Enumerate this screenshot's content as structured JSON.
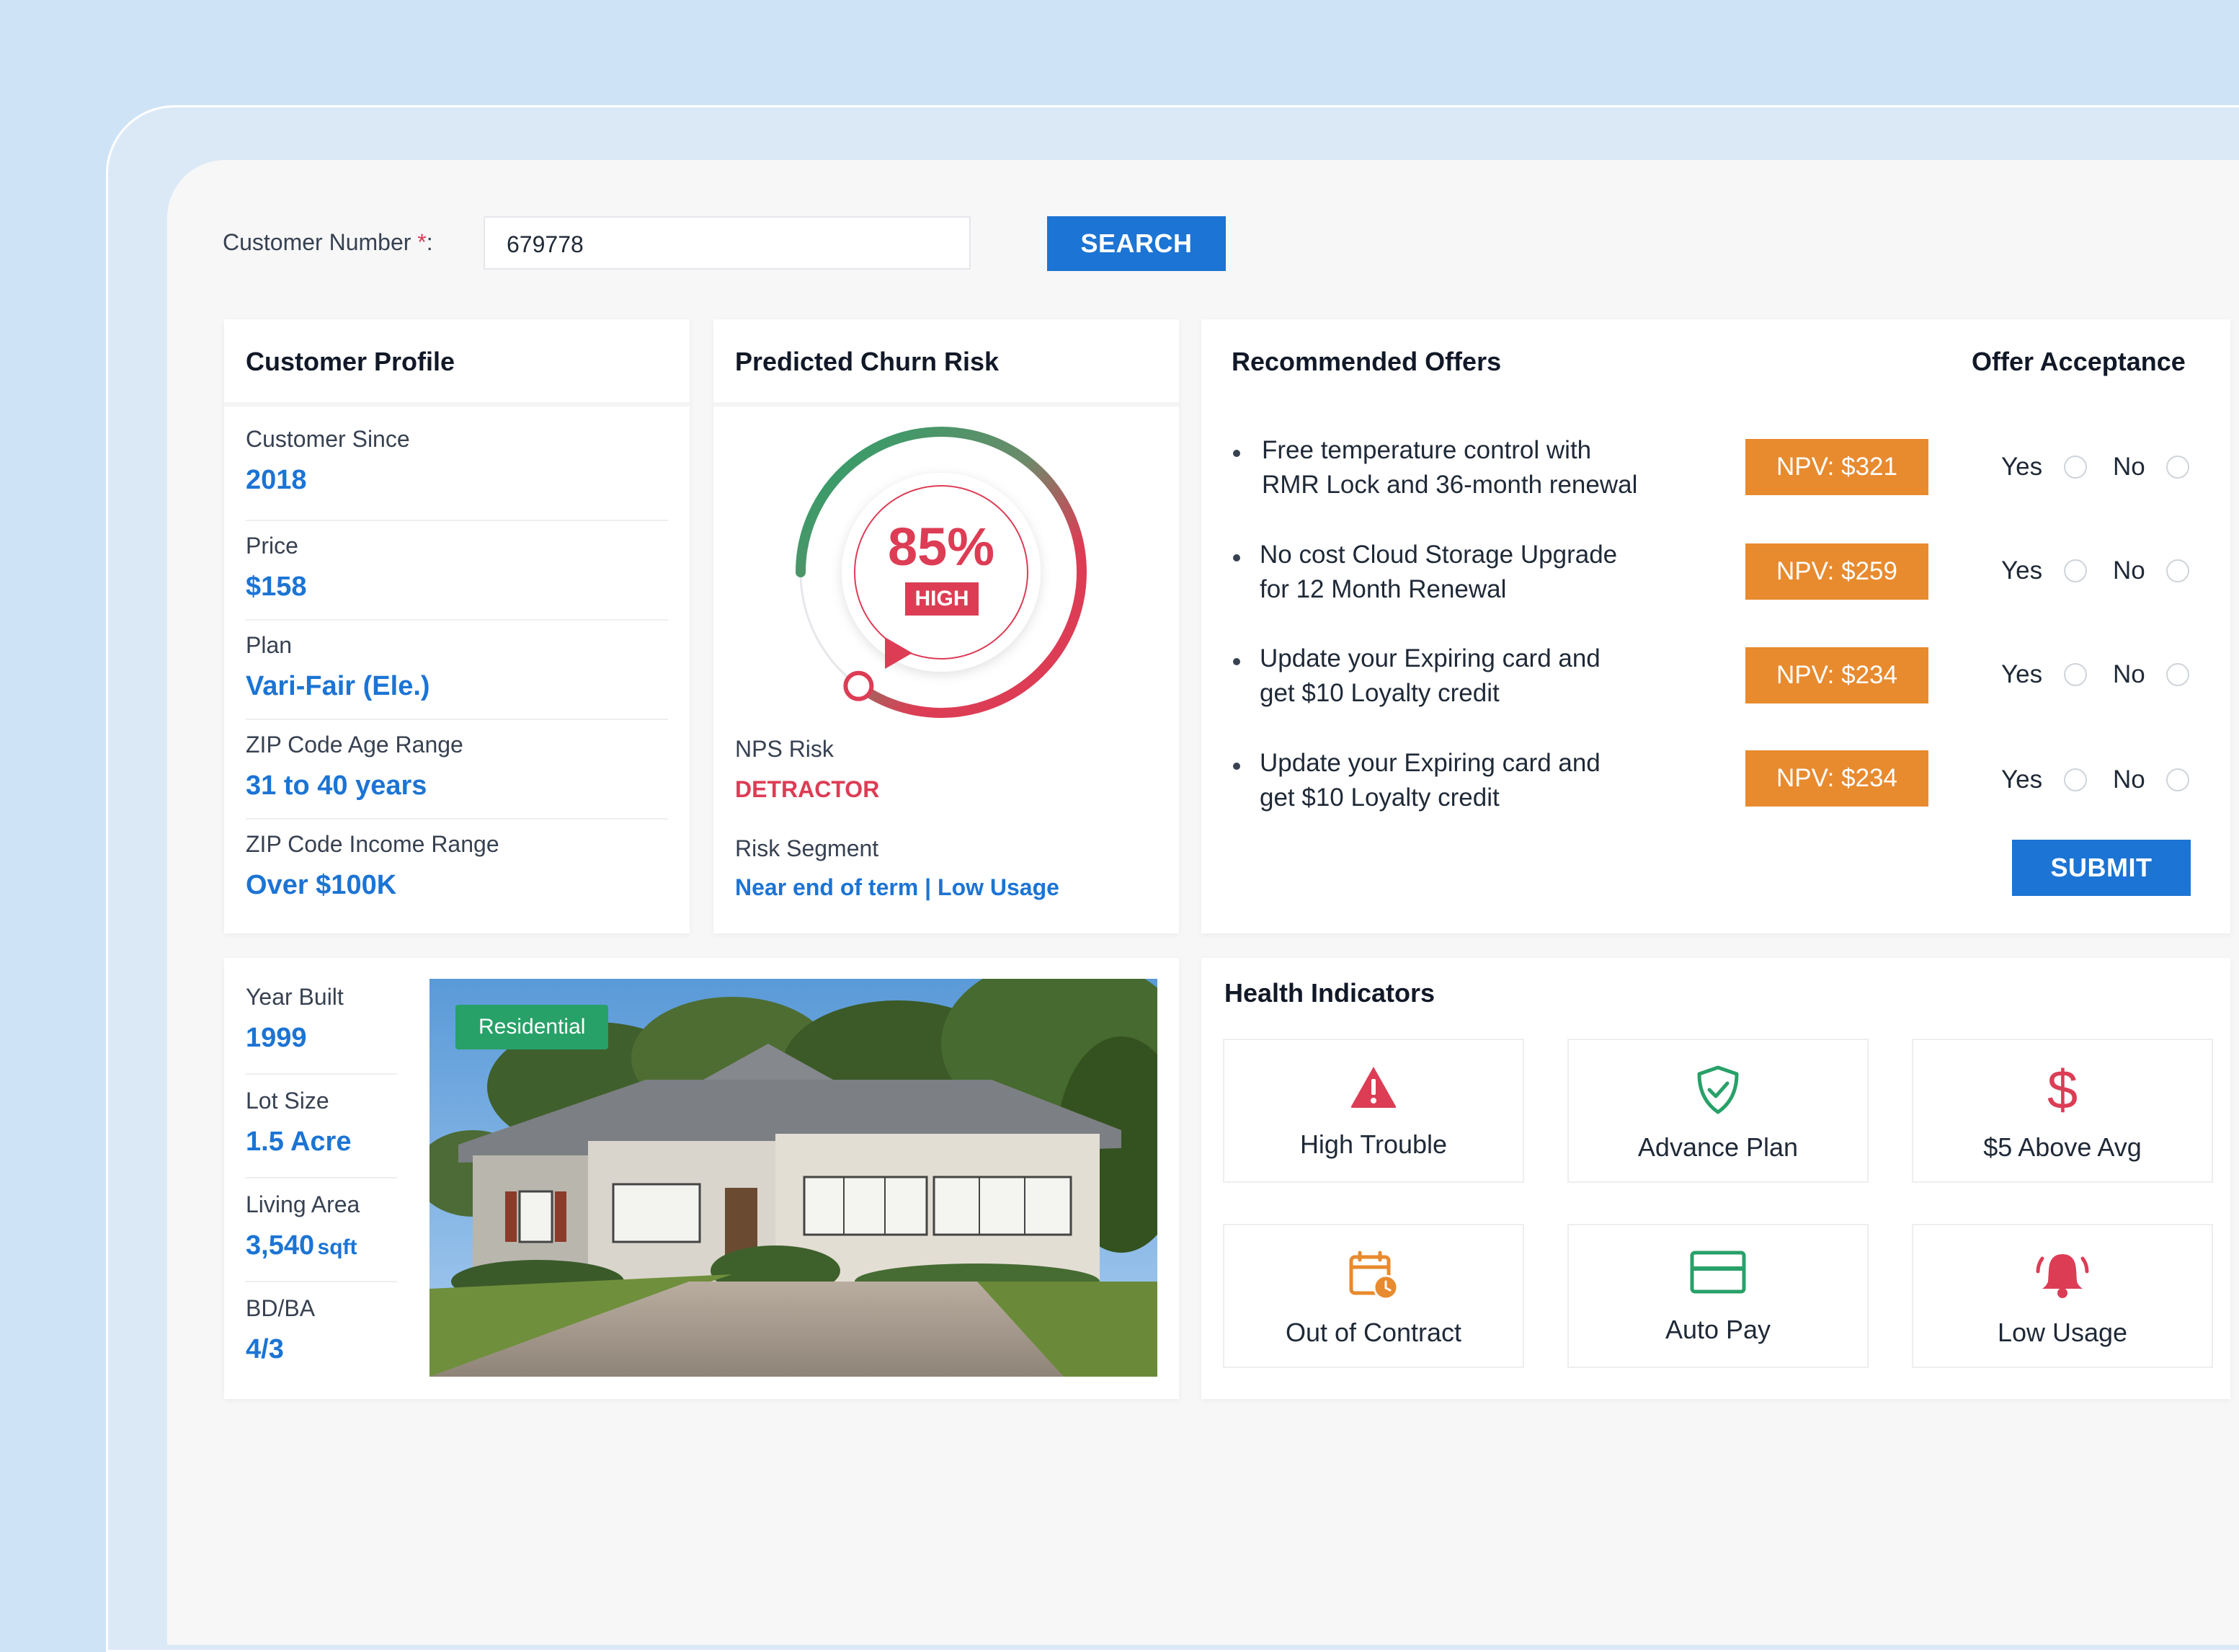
{
  "search": {
    "label": "Customer Number",
    "required_mark": "*",
    "label_suffix": ":",
    "value": "679778",
    "button": "SEARCH"
  },
  "profile": {
    "title": "Customer Profile",
    "fields": [
      {
        "label": "Customer Since",
        "value": "2018"
      },
      {
        "label": "Price",
        "value": "$158"
      },
      {
        "label": "Plan",
        "value": "Vari-Fair (Ele.)"
      },
      {
        "label": "ZIP Code Age Range",
        "value": "31 to 40 years"
      },
      {
        "label": "ZIP Code Income Range",
        "value": "Over $100K"
      }
    ]
  },
  "churn": {
    "title": "Predicted Churn Risk",
    "risk_percent": 85,
    "percent_text": "85%",
    "level": "HIGH",
    "nps_label": "NPS Risk",
    "nps_value": "DETRACTOR",
    "segment_label": "Risk Segment",
    "segment_value": "Near end of term | Low Usage"
  },
  "offers": {
    "title": "Recommended Offers",
    "acceptance_title": "Offer Acceptance",
    "yes": "Yes",
    "no": "No",
    "items": [
      {
        "line1": "Free temperature control with",
        "line2": "RMR Lock and 36-month renewal",
        "npv": "NPV: $321"
      },
      {
        "line1": "No cost Cloud Storage Upgrade",
        "line2": "for 12 Month Renewal",
        "npv": "NPV: $259"
      },
      {
        "line1": "Update your Expiring card and",
        "line2": "get $10 Loyalty credit",
        "npv": "NPV: $234"
      },
      {
        "line1": "Update your Expiring card and",
        "line2": "get $10 Loyalty credit",
        "npv": "NPV: $234"
      }
    ],
    "submit": "SUBMIT"
  },
  "property": {
    "fields": [
      {
        "label": "Year Built",
        "value": "1999",
        "unit": ""
      },
      {
        "label": "Lot Size",
        "value": "1.5 Acre",
        "unit": ""
      },
      {
        "label": "Living Area",
        "value": "3,540",
        "unit": "sqft"
      },
      {
        "label": "BD/BA",
        "value": "4/3",
        "unit": ""
      }
    ],
    "badge": "Residential"
  },
  "health": {
    "title": "Health Indicators",
    "tiles": [
      {
        "label": "High Trouble",
        "icon": "warning-triangle-icon",
        "color": "#dc3d55"
      },
      {
        "label": "Advance Plan",
        "icon": "shield-check-icon",
        "color": "#27a168"
      },
      {
        "label": "$5 Above Avg",
        "icon": "dollar-icon",
        "color": "#dc3d55"
      },
      {
        "label": "Out of Contract",
        "icon": "calendar-clock-icon",
        "color": "#e88a2e"
      },
      {
        "label": "Auto Pay",
        "icon": "credit-card-icon",
        "color": "#27a168"
      },
      {
        "label": "Low Usage",
        "icon": "bell-icon",
        "color": "#dc3d55"
      }
    ]
  },
  "colors": {
    "primary": "#1c74d4",
    "danger": "#dc3d55",
    "success": "#27a168",
    "warning": "#e88a2e"
  }
}
